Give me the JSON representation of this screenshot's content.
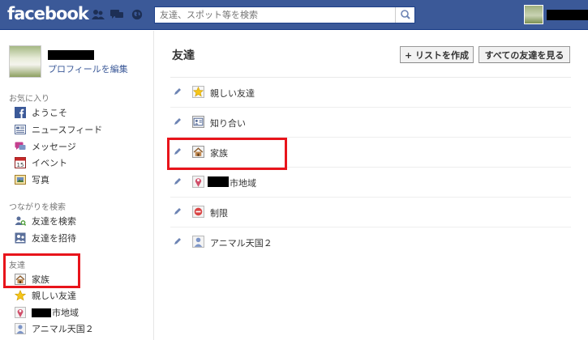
{
  "topbar": {
    "logo": "facebook",
    "search_placeholder": "友達、スポット等を検索"
  },
  "sidebar": {
    "edit_profile": "プロフィールを編集",
    "favorites_header": "お気に入り",
    "favorites": [
      {
        "label": "ようこそ",
        "icon": "facebook-icon"
      },
      {
        "label": "ニュースフィード",
        "icon": "news-feed-icon"
      },
      {
        "label": "メッセージ",
        "icon": "messages-icon"
      },
      {
        "label": "イベント",
        "icon": "calendar-icon"
      },
      {
        "label": "写真",
        "icon": "photos-icon"
      }
    ],
    "connect_header": "つながりを検索",
    "connect": [
      {
        "label": "友達を検索",
        "icon": "find-friends-icon"
      },
      {
        "label": "友達を招待",
        "icon": "invite-friends-icon"
      }
    ],
    "friends_header": "友達",
    "friends": [
      {
        "label": "家族",
        "icon": "house-icon"
      },
      {
        "label": "親しい友達",
        "icon": "star-icon"
      },
      {
        "label": "市地域",
        "icon": "location-pin-icon"
      },
      {
        "label": "アニマル天国２",
        "icon": "person-icon"
      }
    ]
  },
  "main": {
    "title": "友達",
    "create_list_button": "+ リストを作成",
    "see_all_button": "すべての友達を見る",
    "lists": [
      {
        "label": "親しい友達",
        "icon": "star-icon"
      },
      {
        "label": "知り合い",
        "icon": "acquaintance-icon"
      },
      {
        "label": "家族",
        "icon": "house-icon"
      },
      {
        "label": "市地域",
        "icon": "location-pin-icon"
      },
      {
        "label": "制限",
        "icon": "restricted-icon"
      },
      {
        "label": "アニマル天国２",
        "icon": "person-icon"
      }
    ]
  },
  "colors": {
    "brand_blue": "#3b5998",
    "highlight_red": "#e8141b"
  }
}
